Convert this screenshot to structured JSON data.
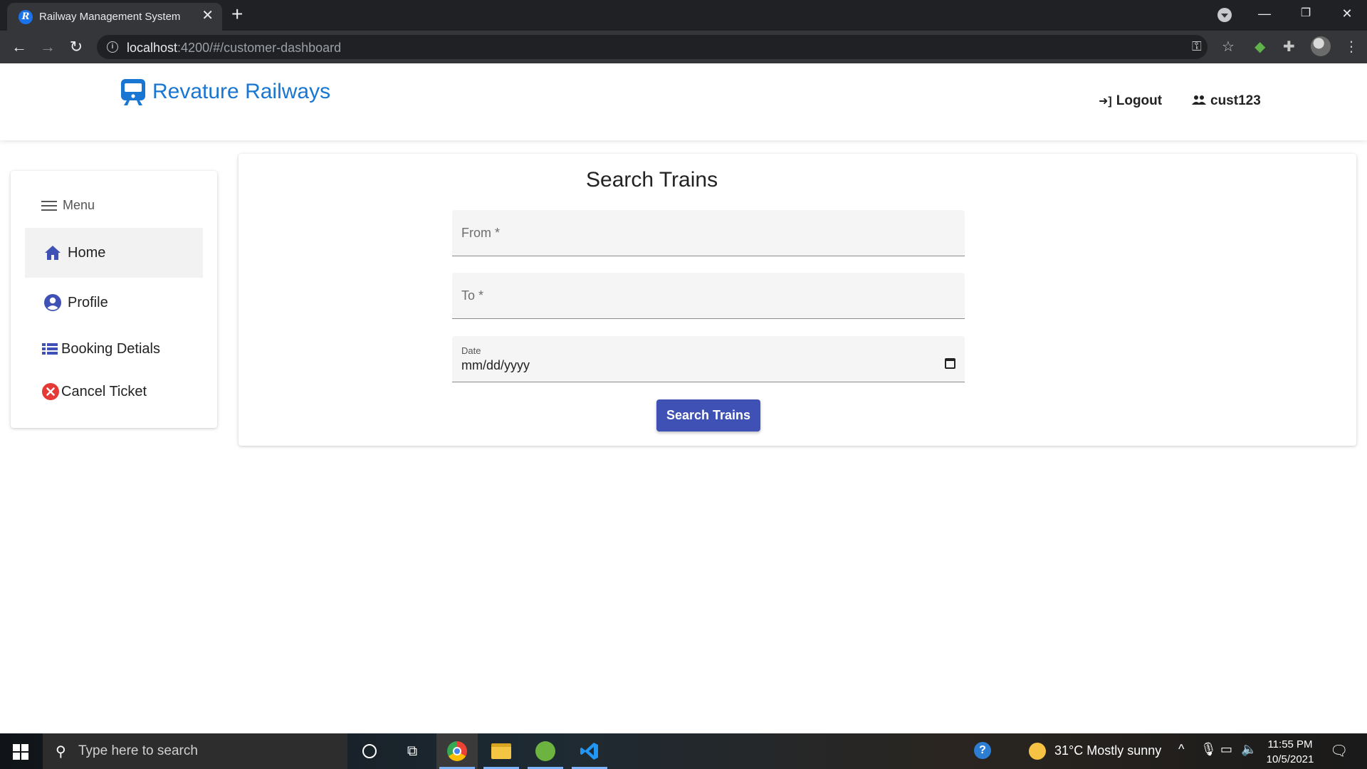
{
  "browser": {
    "tab_title": "Railway Management System",
    "tab_favicon_letter": "R",
    "url_host": "localhost",
    "url_rest": ":4200/#/customer-dashboard"
  },
  "header": {
    "brand_name": "Revature Railways",
    "logout_label": "Logout",
    "user_label": "cust123"
  },
  "sidebar": {
    "menu_label": "Menu",
    "items": [
      {
        "label": "Home",
        "icon": "home-icon"
      },
      {
        "label": "Profile",
        "icon": "account-circle-icon"
      },
      {
        "label": "Booking Detials",
        "icon": "list-icon"
      },
      {
        "label": "Cancel Ticket",
        "icon": "cancel-circle-icon"
      }
    ]
  },
  "search": {
    "title": "Search Trains",
    "from_label": "From *",
    "to_label": "To *",
    "date_label": "Date",
    "date_placeholder": "mm/dd/yyyy",
    "button_label": "Search Trains"
  },
  "taskbar": {
    "search_placeholder": "Type here to search",
    "weather": "31°C  Mostly sunny",
    "time": "11:55 PM",
    "date": "10/5/2021"
  },
  "colors": {
    "brand": "#1976d2",
    "primary_button": "#3f51b5",
    "home_icon": "#3f51b5",
    "cancel_icon": "#e53935"
  }
}
